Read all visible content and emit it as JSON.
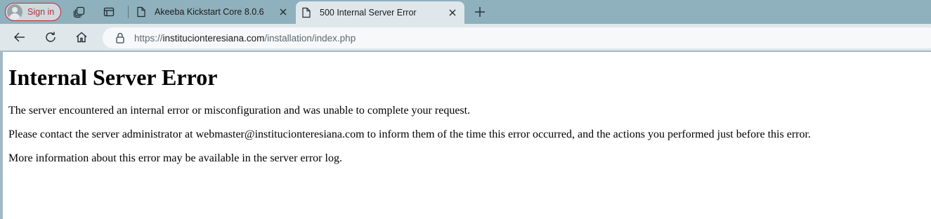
{
  "browser": {
    "sign_in_label": "Sign in",
    "tabs": [
      {
        "title": "Akeeba Kickstart Core 8.0.6",
        "active": false
      },
      {
        "title": "500 Internal Server Error",
        "active": true
      }
    ],
    "address_bar": {
      "scheme": "https://",
      "host": "institucionteresiana.com",
      "path": "/installation/index.php"
    },
    "icons": {
      "profile": "avatar-icon",
      "workspaces": "workspaces-icon",
      "tab_actions": "tab-actions-icon",
      "tab_page": "page-icon",
      "tab_close": "close-icon",
      "new_tab": "plus-icon",
      "back": "back-arrow-icon",
      "refresh": "refresh-icon",
      "home": "home-icon",
      "site_info": "lock-icon"
    },
    "colors": {
      "tab_strip": "#8fb0bd",
      "toolbar": "#dfe7eb",
      "sign_in_accent": "#b3323c"
    }
  },
  "page": {
    "heading": "Internal Server Error",
    "paragraphs": [
      "The server encountered an internal error or misconfiguration and was unable to complete your request.",
      "Please contact the server administrator at webmaster@institucionteresiana.com to inform them of the time this error occurred, and the actions you performed just before this error.",
      "More information about this error may be available in the server error log."
    ]
  }
}
